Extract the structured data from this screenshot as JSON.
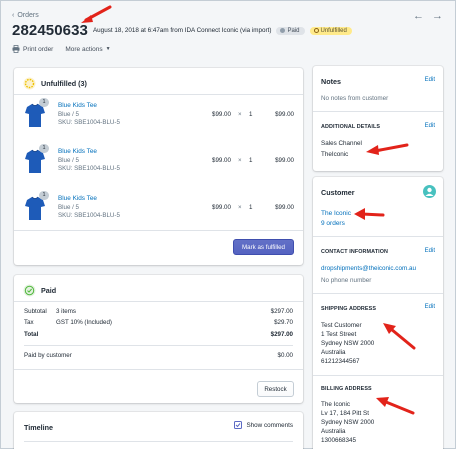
{
  "header": {
    "back_label": "Orders",
    "order_number": "282450633",
    "meta": "August 18, 2018 at 6:47am from IDA Connect Iconic (via import)",
    "badge_paid": "Paid",
    "badge_unfulfilled": "Unfulfilled",
    "print_label": "Print order",
    "more_actions_label": "More actions"
  },
  "unfulfilled": {
    "title": "Unfulfilled (3)",
    "items": [
      {
        "qty_badge": "1",
        "name": "Blue Kids Tee",
        "variant": "Blue / 5",
        "sku": "SKU: SBE1004-BLU-5",
        "price": "$99.00",
        "x": "×",
        "qty": "1",
        "total": "$99.00"
      },
      {
        "qty_badge": "1",
        "name": "Blue Kids Tee",
        "variant": "Blue / 5",
        "sku": "SKU: SBE1004-BLU-5",
        "price": "$99.00",
        "x": "×",
        "qty": "1",
        "total": "$99.00"
      },
      {
        "qty_badge": "1",
        "name": "Blue Kids Tee",
        "variant": "Blue / 5",
        "sku": "SKU: SBE1004-BLU-5",
        "price": "$99.00",
        "x": "×",
        "qty": "1",
        "total": "$99.00"
      }
    ],
    "button": "Mark as fulfilled"
  },
  "paid": {
    "title": "Paid",
    "subtotal_label": "Subtotal",
    "subtotal_items": "3 items",
    "subtotal_value": "$297.00",
    "tax_label": "Tax",
    "tax_desc": "GST 10% (Included)",
    "tax_value": "$29.70",
    "total_label": "Total",
    "total_value": "$297.00",
    "paid_by_label": "Paid by customer",
    "paid_by_value": "$0.00",
    "restock_button": "Restock"
  },
  "timeline": {
    "title": "Timeline",
    "show_comments": "Show comments"
  },
  "notes": {
    "title": "Notes",
    "edit": "Edit",
    "empty": "No notes from customer",
    "additional_title": "ADDITIONAL DETAILS",
    "additional_edit": "Edit",
    "sales_channel_label": "Sales Channel",
    "sales_channel_value": "TheIconic"
  },
  "customer": {
    "title": "Customer",
    "name": "The Iconic",
    "orders": "9 orders",
    "contact_title": "CONTACT INFORMATION",
    "contact_edit": "Edit",
    "email": "dropshipments@theiconic.com.au",
    "phone": "No phone number",
    "shipping_title": "SHIPPING ADDRESS",
    "shipping_edit": "Edit",
    "shipping_lines": [
      "Test Customer",
      "1 Test Street",
      "Sydney NSW 2000",
      "Australia",
      "61212344567"
    ],
    "billing_title": "BILLING ADDRESS",
    "billing_lines": [
      "The Iconic",
      "Lv 17, 184 Pitt St",
      "Sydney NSW 2000",
      "Australia",
      "1300668345"
    ]
  },
  "colors": {
    "accent": "#006fbb",
    "primary_button": "#5c6ac4",
    "unfulfilled_badge": "#ffea8a",
    "annotation_arrow": "#e2231a"
  }
}
